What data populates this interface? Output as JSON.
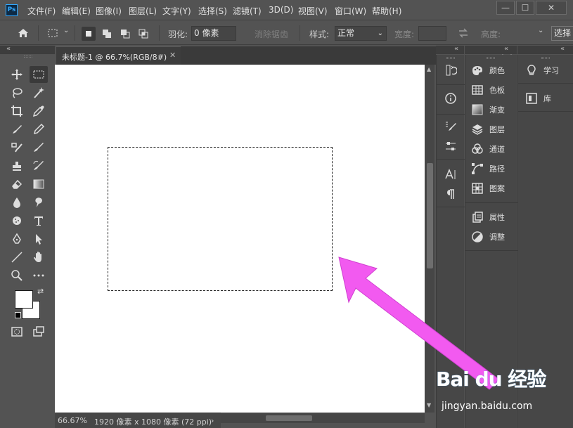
{
  "app": {
    "logo": "Ps"
  },
  "menu": [
    "文件(F)",
    "编辑(E)",
    "图像(I)",
    "图层(L)",
    "文字(Y)",
    "选择(S)",
    "滤镜(T)",
    "3D(D)",
    "视图(V)",
    "窗口(W)",
    "帮助(H)"
  ],
  "window_controls": {
    "minimize": "—",
    "maximize": "☐",
    "close": "✕"
  },
  "options": {
    "feather_label": "羽化:",
    "feather_value": "0 像素",
    "antialias_label": "消除锯齿",
    "style_label": "样式:",
    "style_value": "正常",
    "width_label": "宽度:",
    "width_value": "",
    "height_label": "高度:",
    "select_button": "选择"
  },
  "document": {
    "tab_title": "未标题-1 @ 66.7%(RGB/8#)",
    "zoom": "66.67%",
    "info": "1920 像素 x 1080 像素 (72 ppi)"
  },
  "panels_mid": [
    {
      "icon": "color-icon",
      "label": "颜色"
    },
    {
      "icon": "swatches-icon",
      "label": "色板"
    },
    {
      "icon": "gradient-icon",
      "label": "渐变"
    },
    {
      "icon": "layers-icon",
      "label": "图层"
    },
    {
      "icon": "channels-icon",
      "label": "通道"
    },
    {
      "icon": "paths-icon",
      "label": "路径"
    },
    {
      "icon": "patterns-icon",
      "label": "图案"
    },
    {
      "icon": "properties-icon",
      "label": "属性"
    },
    {
      "icon": "adjustments-icon",
      "label": "调整"
    }
  ],
  "panels_right": [
    {
      "icon": "learn-icon",
      "label": "学习"
    },
    {
      "icon": "libraries-icon",
      "label": "库"
    }
  ],
  "watermark": {
    "main": "Bai du 经验",
    "sub": "jingyan.baidu.com"
  },
  "colors": {
    "arrow": "#f25af0",
    "bg": "#535353",
    "panel": "#474747",
    "canvas": "#ffffff"
  }
}
